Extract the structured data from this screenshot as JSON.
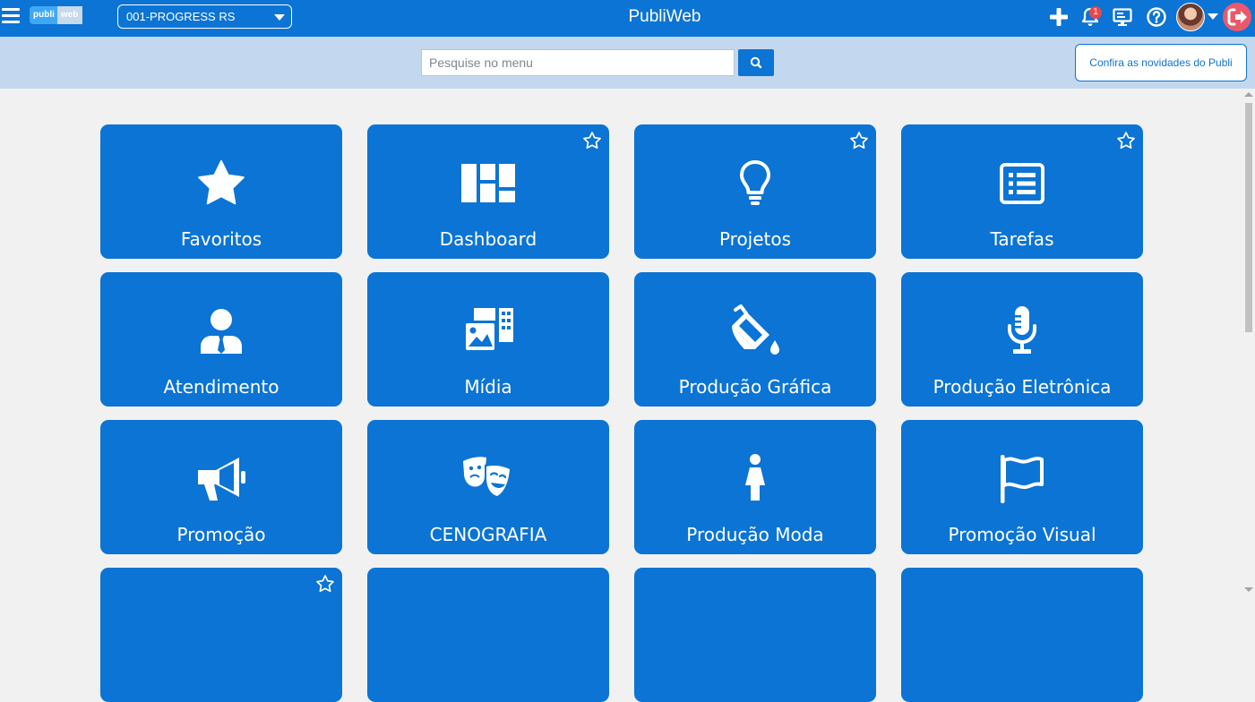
{
  "header": {
    "logo_text_left": "publi",
    "logo_text_right": "web",
    "company_selected": "001-PROGRESS RS",
    "title": "PubliWeb",
    "notification_count": "1",
    "icons": [
      "plus-icon",
      "bell-icon",
      "monitor-icon",
      "help-icon",
      "avatar",
      "logout-icon"
    ]
  },
  "search": {
    "placeholder": "Pesquise no menu",
    "value": "",
    "news_label": "Confira as novidades do Publi"
  },
  "tiles": [
    {
      "label": "Favoritos",
      "icon": "star-icon",
      "favorite_toggle": false
    },
    {
      "label": "Dashboard",
      "icon": "dashboard-icon",
      "favorite_toggle": true
    },
    {
      "label": "Projetos",
      "icon": "lightbulb-icon",
      "favorite_toggle": true
    },
    {
      "label": "Tarefas",
      "icon": "task-list-icon",
      "favorite_toggle": true
    },
    {
      "label": "Atendimento",
      "icon": "user-tie-icon",
      "favorite_toggle": false
    },
    {
      "label": "Mídia",
      "icon": "media-icon",
      "favorite_toggle": false
    },
    {
      "label": "Produção Gráfica",
      "icon": "paint-bucket-icon",
      "favorite_toggle": false
    },
    {
      "label": "Produção Eletrônica",
      "icon": "microphone-icon",
      "favorite_toggle": false
    },
    {
      "label": "Promoção",
      "icon": "megaphone-icon",
      "favorite_toggle": false
    },
    {
      "label": "CENOGRAFIA",
      "icon": "theater-masks-icon",
      "favorite_toggle": false
    },
    {
      "label": "Produção Moda",
      "icon": "female-icon",
      "favorite_toggle": false
    },
    {
      "label": "Promoção Visual",
      "icon": "flag-icon",
      "favorite_toggle": false
    }
  ],
  "colors": {
    "primary": "#0b74d4",
    "search_band": "#c3d8ee",
    "background": "#f1f1f1",
    "logout": "#e9596b",
    "badge": "#e84848"
  }
}
